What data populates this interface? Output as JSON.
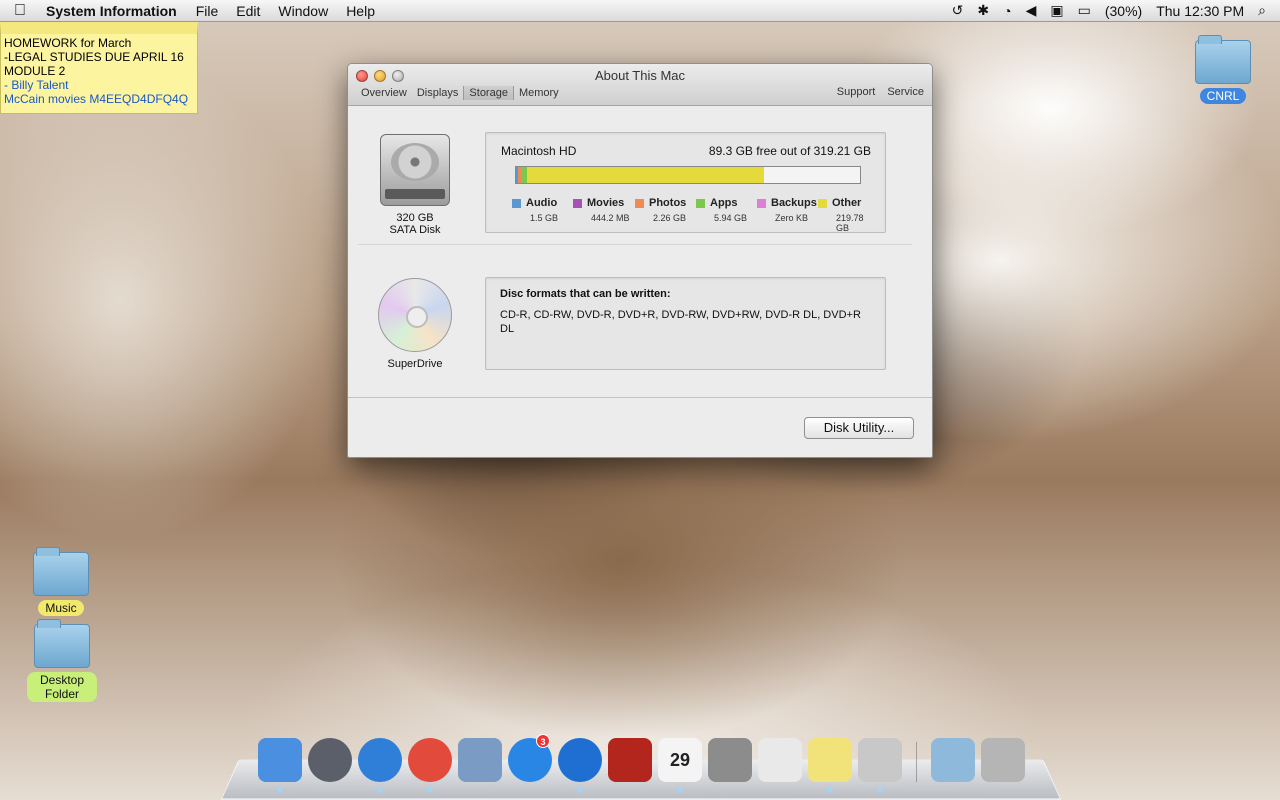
{
  "menubar": {
    "app_name": "System Information",
    "menus": [
      "File",
      "Edit",
      "Window",
      "Help"
    ],
    "battery_percent": "(30%)",
    "clock": "Thu 12:30 PM"
  },
  "sticky_note": {
    "lines": [
      "HOMEWORK for March",
      "-LEGAL STUDIES DUE APRIL 16",
      "MODULE 2",
      "- Billy Talent",
      "McCain movies M4EEQD4DFQ4Q"
    ]
  },
  "desktop": {
    "icons": [
      {
        "label": "CNRL"
      },
      {
        "label": "Music"
      },
      {
        "label": "Desktop Folder"
      }
    ]
  },
  "window": {
    "title": "About This Mac",
    "tabs": [
      "Overview",
      "Displays",
      "Storage",
      "Memory"
    ],
    "active_tab": "Storage",
    "right_tabs": [
      "Support",
      "Service"
    ],
    "hard_disk": {
      "icon_line1": "320 GB",
      "icon_line2": "SATA Disk",
      "name": "Macintosh HD",
      "free_text": "89.3 GB free out of 319.21 GB",
      "legend": [
        {
          "name": "Audio",
          "value": "1.5 GB",
          "color": "#5b97d1"
        },
        {
          "name": "Movies",
          "value": "444.2 MB",
          "color": "#a453b5"
        },
        {
          "name": "Photos",
          "value": "2.26 GB",
          "color": "#ee8a55"
        },
        {
          "name": "Apps",
          "value": "5.94 GB",
          "color": "#7cc84c"
        },
        {
          "name": "Backups",
          "value": "Zero KB",
          "color": "#de7fd6"
        },
        {
          "name": "Other",
          "value": "219.78 GB",
          "color": "#e4da3c"
        }
      ],
      "used_fractions": [
        0.0047,
        0.0014,
        0.0071,
        0.0186,
        0.0,
        0.6885
      ]
    },
    "superdrive": {
      "label": "SuperDrive",
      "formats_title": "Disc formats that can be written:",
      "formats_text": "CD-R, CD-RW, DVD-R, DVD+R, DVD-RW, DVD+RW, DVD-R DL, DVD+R DL"
    },
    "disk_utility_button": "Disk Utility..."
  },
  "dock": {
    "items": [
      {
        "name": "finder-icon",
        "color": "#4a8fe0",
        "running": true
      },
      {
        "name": "launchpad-icon",
        "color": "#5a5f6a",
        "running": false
      },
      {
        "name": "safari-icon",
        "color": "#2f7fd8",
        "running": true
      },
      {
        "name": "chrome-icon",
        "color": "#e24a3b",
        "running": true
      },
      {
        "name": "mail-icon",
        "color": "#7a9cc4",
        "running": false
      },
      {
        "name": "app-store-icon",
        "color": "#2a86e4",
        "running": false,
        "badge": "3"
      },
      {
        "name": "itunes-icon",
        "color": "#1f6fd2",
        "running": true
      },
      {
        "name": "photo-booth-icon",
        "color": "#b3261e",
        "running": false
      },
      {
        "name": "calendar-icon",
        "color": "#f4f4f4",
        "running": true,
        "text": "29"
      },
      {
        "name": "system-preferences-icon",
        "color": "#8c8c8c",
        "running": false
      },
      {
        "name": "textedit-icon",
        "color": "#e9e9e9",
        "running": false
      },
      {
        "name": "stickies-icon",
        "color": "#f2e27a",
        "running": true
      },
      {
        "name": "system-information-icon",
        "color": "#c8c8c8",
        "running": true
      },
      {
        "name": "downloads-stack-icon",
        "color": "#8fb9da",
        "running": false
      },
      {
        "name": "trash-icon",
        "color": "#b5b5b5",
        "running": false
      }
    ]
  }
}
